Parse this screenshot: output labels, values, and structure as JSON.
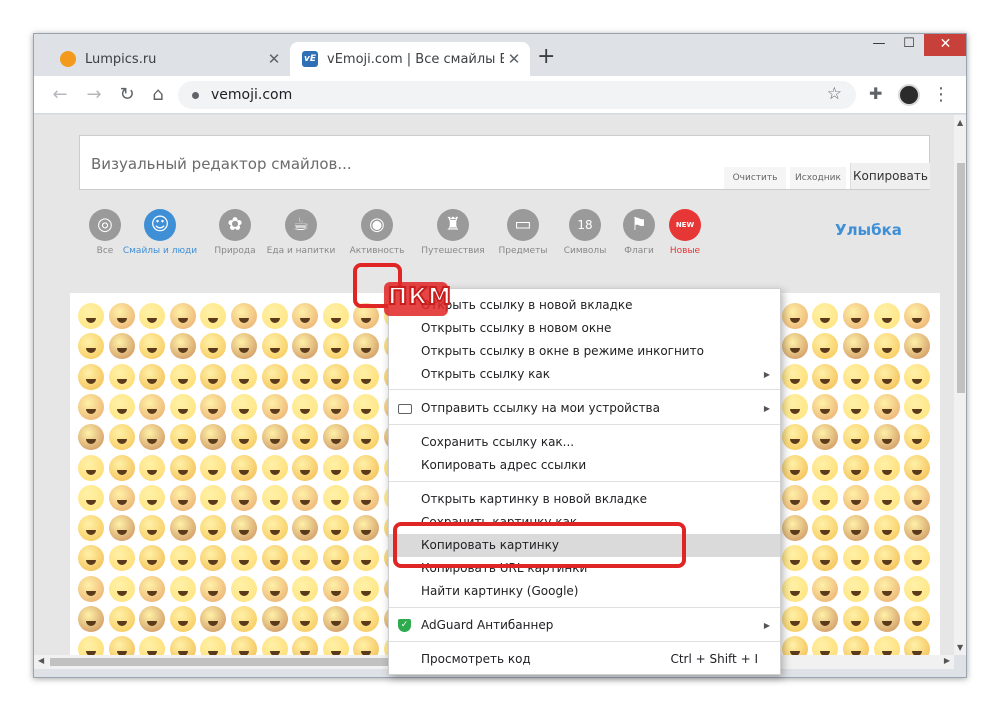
{
  "browser": {
    "tabs": [
      {
        "title": "Lumpics.ru",
        "favicon": "orange-circle-icon",
        "active": false
      },
      {
        "title": "vEmoji.com | Все смайлы ВКонта",
        "favicon": "vemoji-logo-icon",
        "favicon_text": "vE",
        "active": true
      }
    ],
    "close_glyph": "✕",
    "new_tab_glyph": "+",
    "window_controls": {
      "minimize": "—",
      "maximize": "☐",
      "close": "✕"
    },
    "nav": {
      "back": "←",
      "forward": "→",
      "reload": "↻",
      "home": "⌂"
    },
    "url": "vemoji.com",
    "bookmark_glyph": "☆",
    "extensions_glyph": "✚",
    "menu_glyph": "⋮"
  },
  "editor": {
    "placeholder": "Визуальный редактор смайлов...",
    "clear_label": "Очистить",
    "source_label": "Исходник",
    "copy_label": "Копировать"
  },
  "categories": {
    "items": [
      {
        "label": "Все",
        "icon": "spiral-icon",
        "glyph": "◎"
      },
      {
        "label": "Смайлы и люди",
        "icon": "smiley-people-icon",
        "glyph": "☺",
        "active": true
      },
      {
        "label": "Природа",
        "icon": "monkey-icon",
        "glyph": "✿"
      },
      {
        "label": "Еда и напитки",
        "icon": "food-icon",
        "glyph": "☕"
      },
      {
        "label": "Активность",
        "icon": "target-icon",
        "glyph": "◉"
      },
      {
        "label": "Путешествия",
        "icon": "castle-icon",
        "glyph": "♜"
      },
      {
        "label": "Предметы",
        "icon": "computer-icon",
        "glyph": "▭"
      },
      {
        "label": "Символы",
        "icon": "symbol-18-icon",
        "glyph": "18"
      },
      {
        "label": "Флаги",
        "icon": "flag-icon",
        "glyph": "⚑"
      },
      {
        "label": "Новые",
        "icon": "new-badge-icon",
        "glyph": "NEW",
        "new": true
      }
    ],
    "current_title": "Улыбка",
    "active_color": "#3f8fd6",
    "new_color": "#e63636"
  },
  "annotation": {
    "label": "ПКМ",
    "color": "#e02525"
  },
  "context_menu": {
    "items": [
      {
        "label": "Открыть ссылку в новой вкладке"
      },
      {
        "label": "Открыть ссылку в новом окне"
      },
      {
        "label": "Открыть ссылку в окне в режиме инкогнито"
      },
      {
        "label": "Открыть ссылку как",
        "submenu": true
      },
      {
        "label": "Отправить ссылку на мои устройства",
        "submenu": true,
        "icon": "devices-icon"
      },
      {
        "label": "Сохранить ссылку как..."
      },
      {
        "label": "Копировать адрес ссылки"
      },
      {
        "label": "Открыть картинку в новой вкладке"
      },
      {
        "label": "Сохранить картинку как..."
      },
      {
        "label": "Копировать картинку",
        "highlighted": true
      },
      {
        "label": "Копировать URL картинки"
      },
      {
        "label": "Найти картинку (Google)"
      },
      {
        "label": "AdGuard Антибаннер",
        "submenu": true,
        "icon": "adguard-shield-icon"
      },
      {
        "label": "Просмотреть код",
        "shortcut": "Ctrl + Shift + I"
      }
    ],
    "submenu_glyph": "▶"
  }
}
